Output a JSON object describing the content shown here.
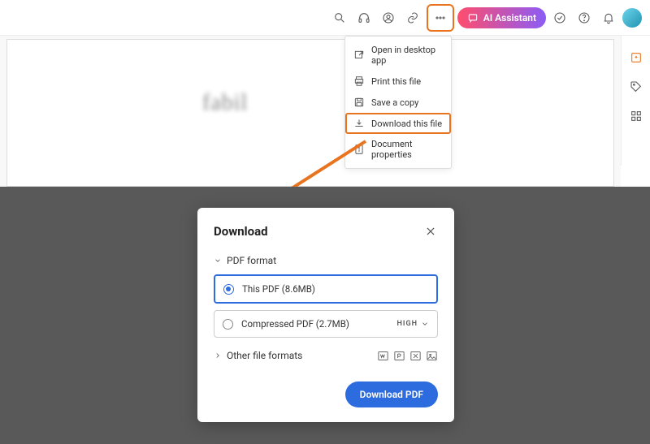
{
  "toolbar": {
    "ai_label": "AI Assistant"
  },
  "menu": {
    "open_desktop": "Open in desktop app",
    "print": "Print this file",
    "save_copy": "Save a copy",
    "download": "Download this file",
    "properties": "Document properties"
  },
  "dialog": {
    "title": "Download",
    "pdf_format_label": "PDF format",
    "this_pdf": "This PDF (8.6MB)",
    "compressed_pdf": "Compressed PDF (2.7MB)",
    "quality_label": "HIGH",
    "other_formats_label": "Other file formats",
    "download_button": "Download PDF"
  },
  "signature_text": "fabil"
}
